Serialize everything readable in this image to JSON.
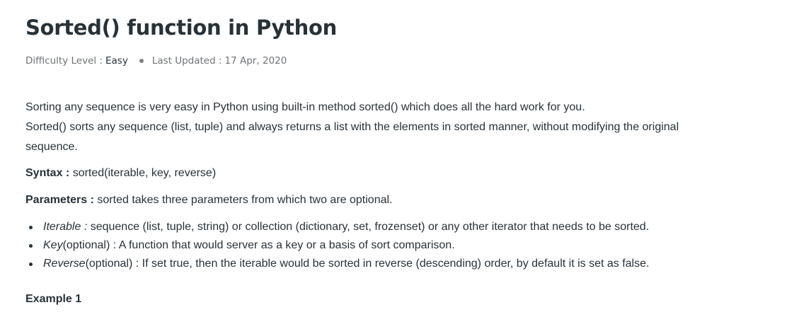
{
  "article": {
    "title": "Sorted() function in Python",
    "meta": {
      "difficulty_label": "Difficulty Level :",
      "difficulty_value": "Easy",
      "updated_label": "Last Updated :",
      "updated_value": "17 Apr, 2020"
    },
    "intro": [
      "Sorting any sequence is very easy in Python using built-in method sorted() which does all the hard work for you.",
      "Sorted() sorts any sequence (list, tuple) and always returns a list with the elements in sorted manner, without modifying the original",
      "sequence."
    ],
    "syntax": {
      "label": "Syntax :",
      "text": " sorted(iterable, key, reverse)"
    },
    "parameters": {
      "label": "Parameters :",
      "text": " sorted takes three parameters from which two are optional."
    },
    "bullets": [
      {
        "term": "Iterable :",
        "text": " sequence (list, tuple, string) or collection (dictionary, set, frozenset) or any other iterator that needs to be sorted."
      },
      {
        "term": "Key",
        "text": "(optional) : A function that would server as a key or a basis of sort comparison."
      },
      {
        "term": "Reverse",
        "text": "(optional) : If set true, then the iterable would be sorted in reverse (descending) order, by default it is set as false."
      }
    ],
    "example_heading": "Example 1"
  },
  "colors": {
    "text": "#273239",
    "meta_text": "#6e7275",
    "background": "#ffffff"
  }
}
